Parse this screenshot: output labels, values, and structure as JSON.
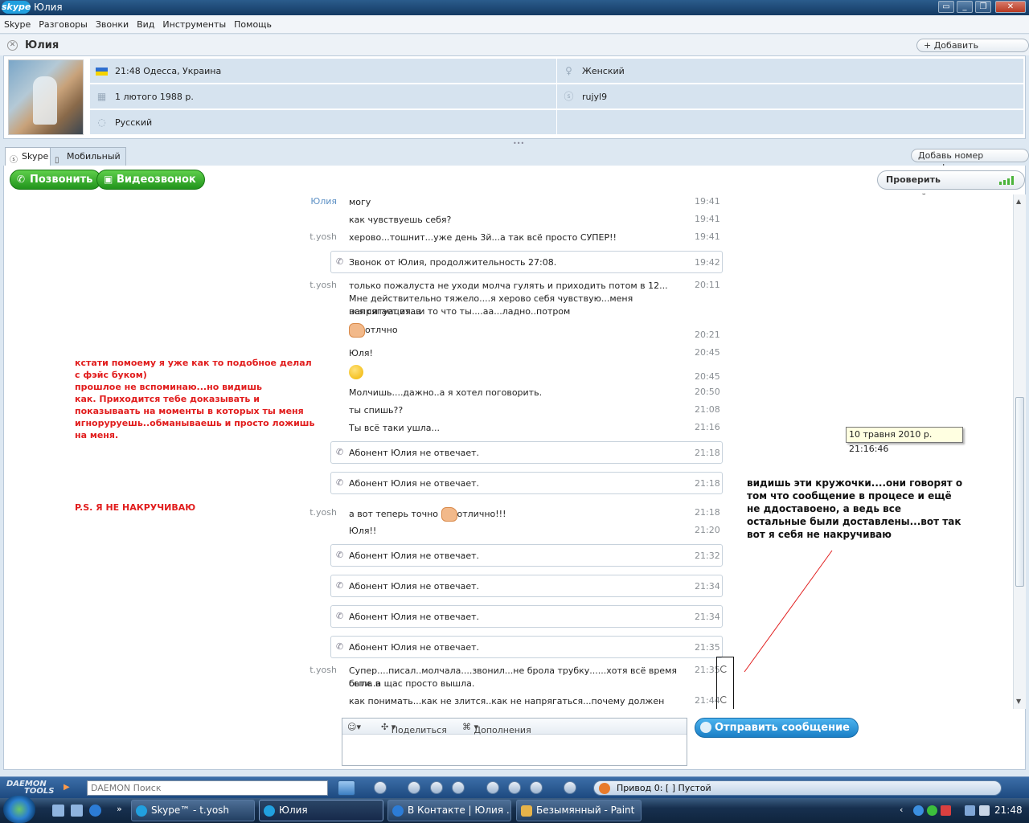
{
  "window": {
    "app_logo": "skype",
    "title": "Юлия"
  },
  "menu": [
    "Skype",
    "Разговоры",
    "Звонки",
    "Вид",
    "Инструменты",
    "Помощь"
  ],
  "contact": {
    "name": "Юлия",
    "add_contacts": "+ Добавить контакты"
  },
  "profile": {
    "local_time_location": "21:48 Одесса, Украина",
    "birthday": "1 лютого 1988 р.",
    "language": "Русский",
    "gender": "Женский",
    "skype_name": "rujyl9"
  },
  "tabs": {
    "skype": "Skype",
    "mobile": "Мобильный",
    "add_phone": "Добавь номер телефона"
  },
  "callbar": {
    "call": "Позвонить",
    "video": "Видеозвонок",
    "check_settings": "Проверить настройки"
  },
  "messages": [
    {
      "sender": "Юлия",
      "text": "могу",
      "time": "19:41"
    },
    {
      "sender": "",
      "text": "как чувствуешь себя?",
      "time": "19:41"
    },
    {
      "sender": "t.yosh",
      "text": "херово...тошнит...уже день 3й...а так всё просто СУПЕР!!",
      "time": "19:41"
    },
    {
      "call": true,
      "text": "Звонок от Юлия, продолжительность 27:08.",
      "time": "19:42"
    },
    {
      "sender": "t.yosh",
      "text": "только пожалуста не уходи молча гулять и приходить потом в 12...",
      "time": "20:11"
    },
    {
      "sender": "",
      "text": "Мне действительно тяжело....я херово себя чувствую...меня напрягает этав",
      "time": ""
    },
    {
      "sender": "",
      "text": "вся ситуация...и то что ты....аа...ладно..потром",
      "time": ""
    },
    {
      "sender": "",
      "text": "отлчно",
      "time": "20:21"
    },
    {
      "sender": "",
      "text": "Юля!",
      "time": "20:45"
    },
    {
      "sender": "",
      "text": "",
      "time": "20:45"
    },
    {
      "sender": "",
      "text": "Молчишь....дажно..а я хотел поговорить.",
      "time": "20:50"
    },
    {
      "sender": "",
      "text": "ты спишь??",
      "time": "21:08"
    },
    {
      "sender": "",
      "text": "Ты всё таки ушла...",
      "time": "21:16"
    },
    {
      "call": true,
      "text": "Абонент Юлия не отвечает.",
      "time": "21:18"
    },
    {
      "call": true,
      "text": "Абонент Юлия не отвечает.",
      "time": "21:18"
    },
    {
      "sender": "t.yosh",
      "text_a": "а вот теперь точно",
      "text_b": "отлично!!!",
      "time": "21:18"
    },
    {
      "sender": "",
      "text": "Юля!!",
      "time": "21:20"
    },
    {
      "call": true,
      "text": "Абонент Юлия не отвечает.",
      "time": "21:32"
    },
    {
      "call": true,
      "text": "Абонент Юлия не отвечает.",
      "time": "21:34"
    },
    {
      "call": true,
      "text": "Абонент Юлия не отвечает.",
      "time": "21:34"
    },
    {
      "call": true,
      "text": "Абонент Юлия не отвечает.",
      "time": "21:35"
    },
    {
      "sender": "t.yosh",
      "text": "Супер....писал..молчала....звонил...не брола трубку......хотя всё время была в",
      "time": "21:35"
    },
    {
      "sender": "",
      "text": "сети..а щас просто вышла.",
      "time": ""
    },
    {
      "sender": "",
      "text": "как понимать...как не злится..как не напрягаться...почему должен",
      "time": "21:44"
    }
  ],
  "annotations": {
    "red_lines": [
      "кстати помоему я уже как то подобное делал",
      "с фэйс буком)",
      "прошлое не вспоминаю...но видишь",
      "как. Приходится тебе доказывать и",
      "показываать на моменты в которых ты меня",
      "игноруруешь..обманываешь и просто ложишь",
      "на меня."
    ],
    "red_ps": "P.S. Я НЕ НАКРУЧИВАЮ",
    "black_lines": [
      "видишь эти кружочки....они говорят о",
      "том что сообщение в процесе и ещё",
      "не ддоставоено, а ведь все",
      "остальные были доставлены...вот так",
      "вот я себя не накручиваю"
    ]
  },
  "tooltip": "10 травня 2010 р. 21:16:46",
  "compose": {
    "share": "Поделиться",
    "extras": "Дополнения",
    "send": "Отправить сообщение"
  },
  "daemon": {
    "logo_line1": "DAEMON",
    "logo_line2": "TOOLS",
    "search_placeholder": "DAEMON Поиск",
    "drive": "Привод 0: [  ] Пустой"
  },
  "taskbar": {
    "tasks": [
      "Skype™ - t.yosh",
      "Юлия",
      "В Контакте | Юлия ...",
      "Безымянный - Paint"
    ],
    "clock": "21:48"
  },
  "colors": {
    "accent_green": "#21941c",
    "send_blue": "#1a7fc6",
    "annotation_red": "#e11d1d"
  }
}
